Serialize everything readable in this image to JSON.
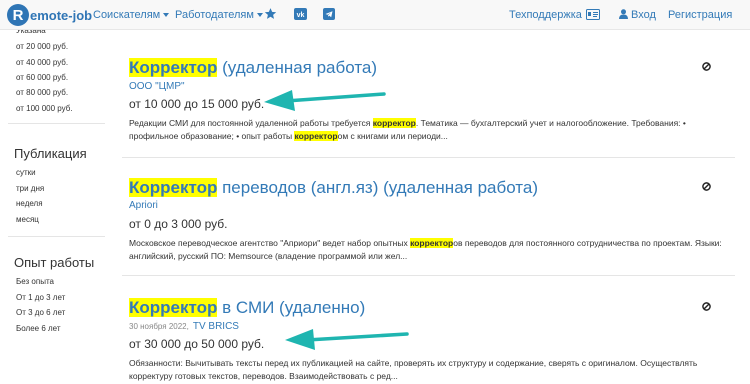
{
  "navbar": {
    "logo_letter": "R",
    "logo_text": "emote-job",
    "job_seekers": "Соискателям",
    "employers": "Работодателям",
    "icons": [
      "star-icon",
      "vk-icon",
      "telegram-icon",
      "id-card-icon",
      "user-icon"
    ],
    "support": "Техподдержка",
    "login": "Вход",
    "register": "Регистрация"
  },
  "sidebar": {
    "partial_top": "Указана",
    "salary_options": [
      "от 20 000 руб.",
      "от 40 000 руб.",
      "от 60 000 руб.",
      "от 80 000 руб.",
      "от 100 000 руб."
    ],
    "publication_title": "Публикация",
    "publication_options": [
      "сутки",
      "три дня",
      "неделя",
      "месяц"
    ],
    "experience_title": "Опыт работы",
    "experience_options": [
      "Без опыта",
      "От 1 до 3 лет",
      "От 3 до 6 лет",
      "Более 6 лет"
    ]
  },
  "jobs": [
    {
      "title_highlight": "Корректор",
      "title_rest": " (удаленная работа)",
      "date": "",
      "company": "ООО \"ЦМР\"",
      "salary": "от 10 000 до 15 000 руб.",
      "desc_1": "Редакции СМИ для постоянной удаленной работы требуется ",
      "desc_hl_1": "корректор",
      "desc_2": ". Тематика — бухгалтерский учет и налогообложение. Требования: • профильное образование; • опыт работы ",
      "desc_hl_2": "корректор",
      "desc_3": "ом с книгами или периоди..."
    },
    {
      "title_highlight": "Корректор",
      "title_rest": " переводов (англ.яз) (удаленная работа)",
      "date": "",
      "company": "Apriori",
      "salary": "от 0 до 3 000 руб.",
      "desc_1": "Московское переводческое агентство \"Априори\" ведет набор опытных ",
      "desc_hl_1": "корректор",
      "desc_2": "ов переводов для постоянного сотрудничества по проектам. Языки: английский, русский ПО: Memsource (владение программой или жел...",
      "desc_hl_2": "",
      "desc_3": ""
    },
    {
      "title_highlight": "Корректор",
      "title_rest": " в СМИ (удаленно)",
      "date": "30 ноября 2022,",
      "company": "TV BRICS",
      "salary": "от 30 000 до 50 000 руб.",
      "desc_1": "Обязанности: Вычитывать тексты перед их публикацией на сайте, проверять их структуру и содержание, сверять с оригиналом. Осуществлять корректуру готовых текстов, переводов. Взаимодействовать с ред...",
      "desc_hl_1": "",
      "desc_2": "",
      "desc_hl_2": "",
      "desc_3": ""
    }
  ],
  "colors": {
    "link": "#337ab7",
    "highlight": "#ffff00",
    "arrow": "#1fb5b0"
  }
}
